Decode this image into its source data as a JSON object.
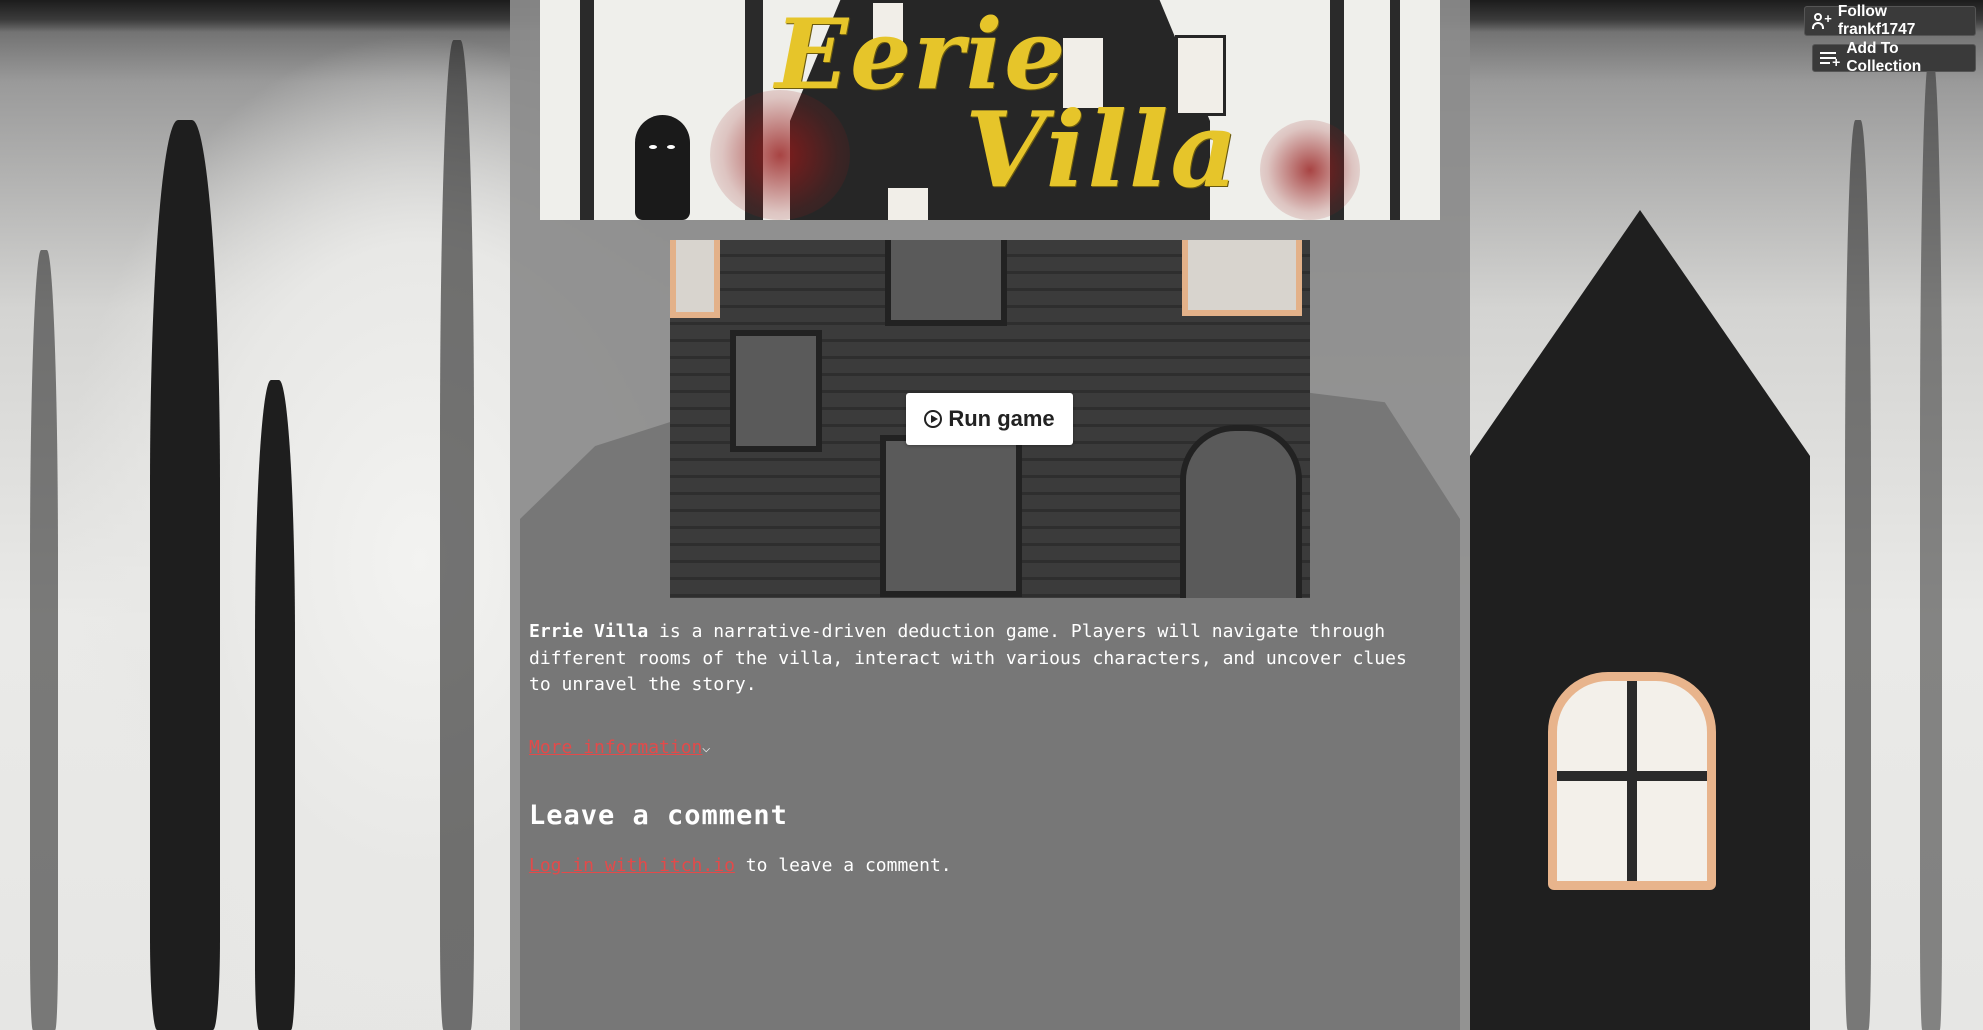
{
  "header": {
    "follow_label": "Follow frankf1747",
    "collection_label": "Add To Collection"
  },
  "banner": {
    "title_line1": "Eerie",
    "title_line2": "Villa",
    "title_color": "#e6c52a"
  },
  "game": {
    "run_label": "Run game"
  },
  "description": {
    "game_name": "Errie Villa",
    "text": " is a narrative-driven deduction game. Players will navigate through different rooms of the villa, interact with various characters, and uncover clues to unravel the story."
  },
  "more_info": {
    "label": "More information",
    "chevron": "⌵"
  },
  "comments": {
    "heading": "Leave a comment",
    "login_link": "Log in with itch.io",
    "login_suffix": " to leave a comment."
  },
  "colors": {
    "link": "#e34a4a",
    "column_bg": "#8c8c8c",
    "text": "#ffffff"
  }
}
